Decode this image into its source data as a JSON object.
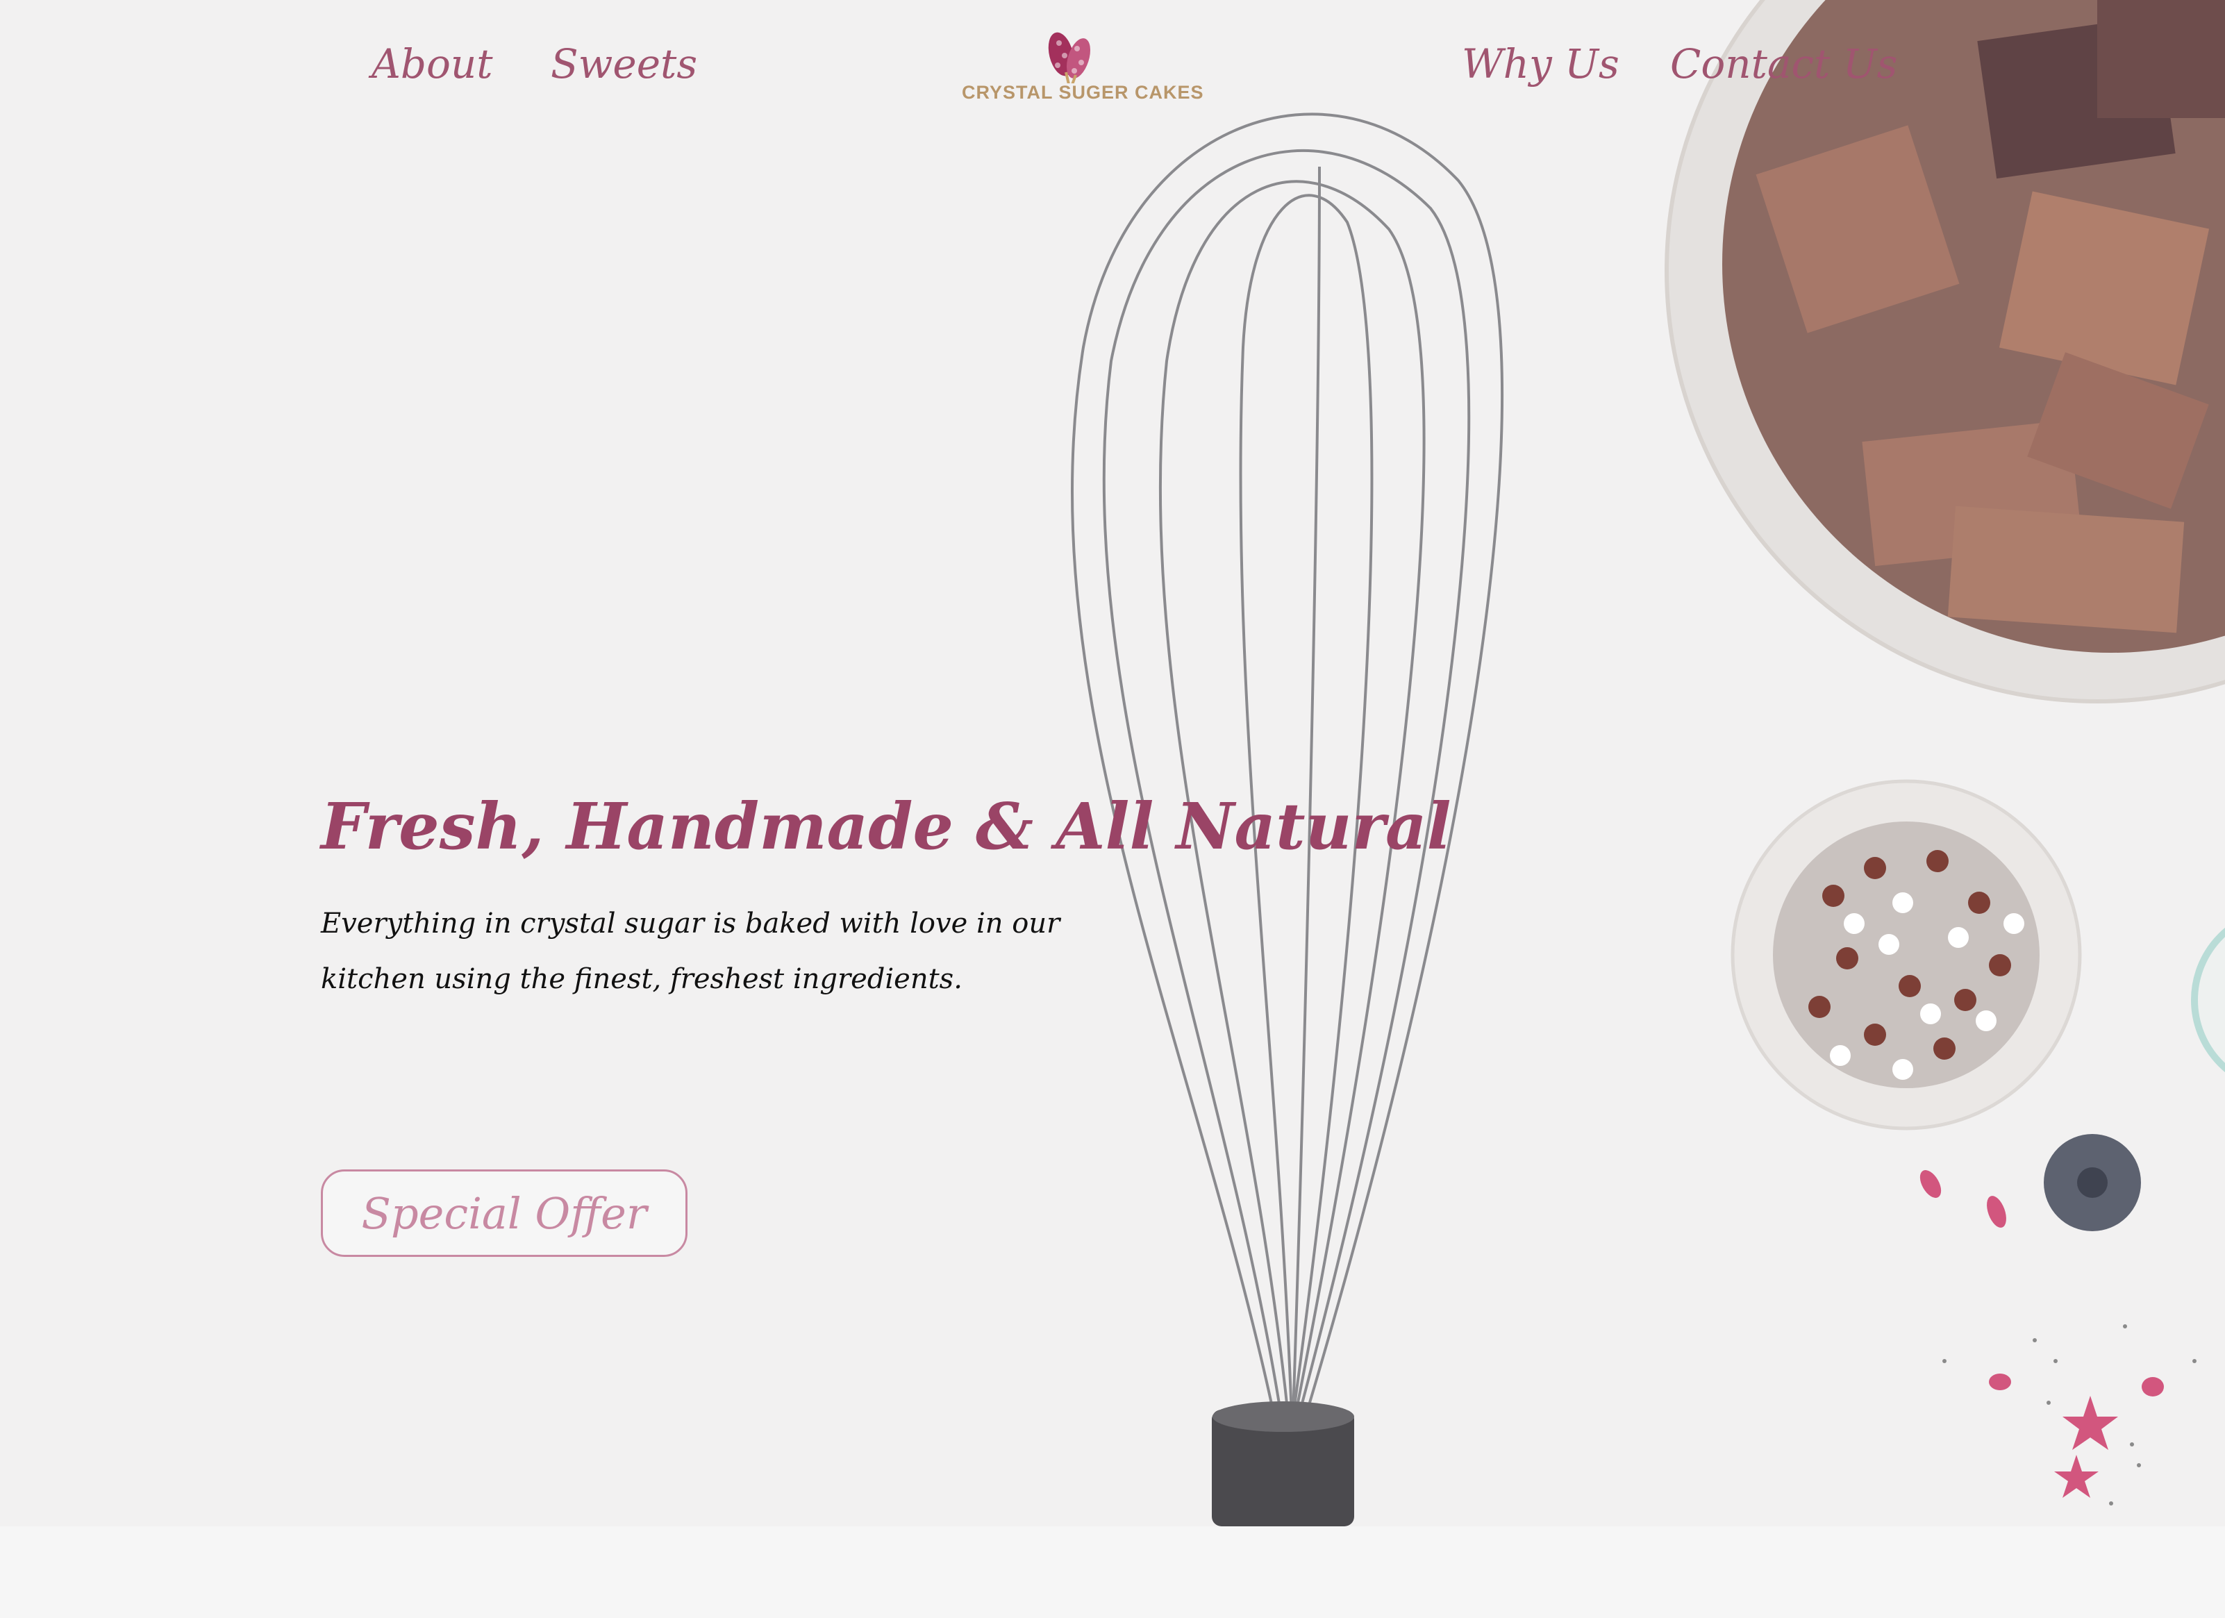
{
  "nav": {
    "left": [
      {
        "label": "About"
      },
      {
        "label": "Sweets"
      }
    ],
    "right": [
      {
        "label": "Why Us"
      },
      {
        "label": "Contact Us"
      }
    ]
  },
  "logo": {
    "text": "CRYSTAL SUGER CAKES"
  },
  "hero": {
    "headline": "Fresh, Handmade & All Natural",
    "lede": "Everything in crystal sugar is baked with love in our kitchen using the finest, freshest ingredients.",
    "cta_label": "Special Offer"
  },
  "colors": {
    "brand": "#9a4466",
    "nav_link": "#a05570",
    "cta_outline": "#c889a2",
    "logo_text": "#b8966a",
    "hero_bg": "#f2f1f1"
  },
  "icons": {
    "logo": "candy-bouquet-logo-icon",
    "decor": [
      "whisk",
      "chocolate-bowl",
      "sprinkles-bowl",
      "blueberry",
      "flower-petals"
    ]
  }
}
